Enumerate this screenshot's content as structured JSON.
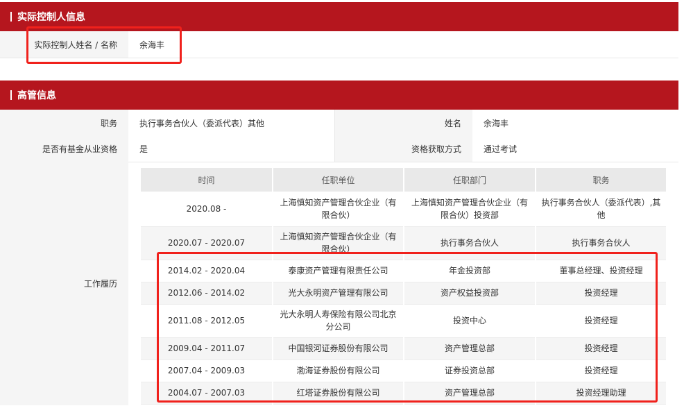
{
  "controller": {
    "section_title": "实际控制人信息",
    "name_label": "实际控制人姓名 / 名称",
    "name_value": "余海丰"
  },
  "executive": {
    "section_title": "高管信息",
    "position_label": "职务",
    "position_value": "执行事务合伙人（委派代表）其他",
    "name_label": "姓名",
    "name_value": "余海丰",
    "qualified_label": "是否有基金从业资格",
    "qualified_value": "是",
    "qual_method_label": "资格获取方式",
    "qual_method_value": "通过考试",
    "history_label": "工作履历"
  },
  "history": {
    "headers": [
      "时间",
      "任职单位",
      "任职部门",
      "职务"
    ],
    "rows": [
      [
        "2020.08 -",
        "上海慎知资产管理合伙企业（有限合伙）",
        "上海慎知资产管理合伙企业（有限合伙）投资部",
        "执行事务合伙人（委派代表）,其他"
      ],
      [
        "2020.07 - 2020.07",
        "上海慎知资产管理合伙企业（有限合伙）",
        "执行事务合伙人",
        "执行事务合伙人"
      ],
      [
        "2014.02 - 2020.04",
        "泰康资产管理有限责任公司",
        "年金投资部",
        "董事总经理、投资经理"
      ],
      [
        "2012.06 - 2014.02",
        "光大永明资产管理有限公司",
        "资产权益投资部",
        "投资经理"
      ],
      [
        "2011.08 - 2012.05",
        "光大永明人寿保险有限公司北京分公司",
        "投资中心",
        "投资经理"
      ],
      [
        "2009.04 - 2011.07",
        "中国银河证券股份有限公司",
        "资产管理总部",
        "投资经理"
      ],
      [
        "2007.04 - 2009.03",
        "渤海证券股份有限公司",
        "证券投资总部",
        "投资经理"
      ],
      [
        "2004.07 - 2007.03",
        "红塔证券股份有限公司",
        "资产管理总部",
        "投资经理助理"
      ]
    ]
  },
  "colors": {
    "header_red": "#b5161e",
    "highlight_red": "#f0211c",
    "label_bg": "#f5f5f5"
  }
}
